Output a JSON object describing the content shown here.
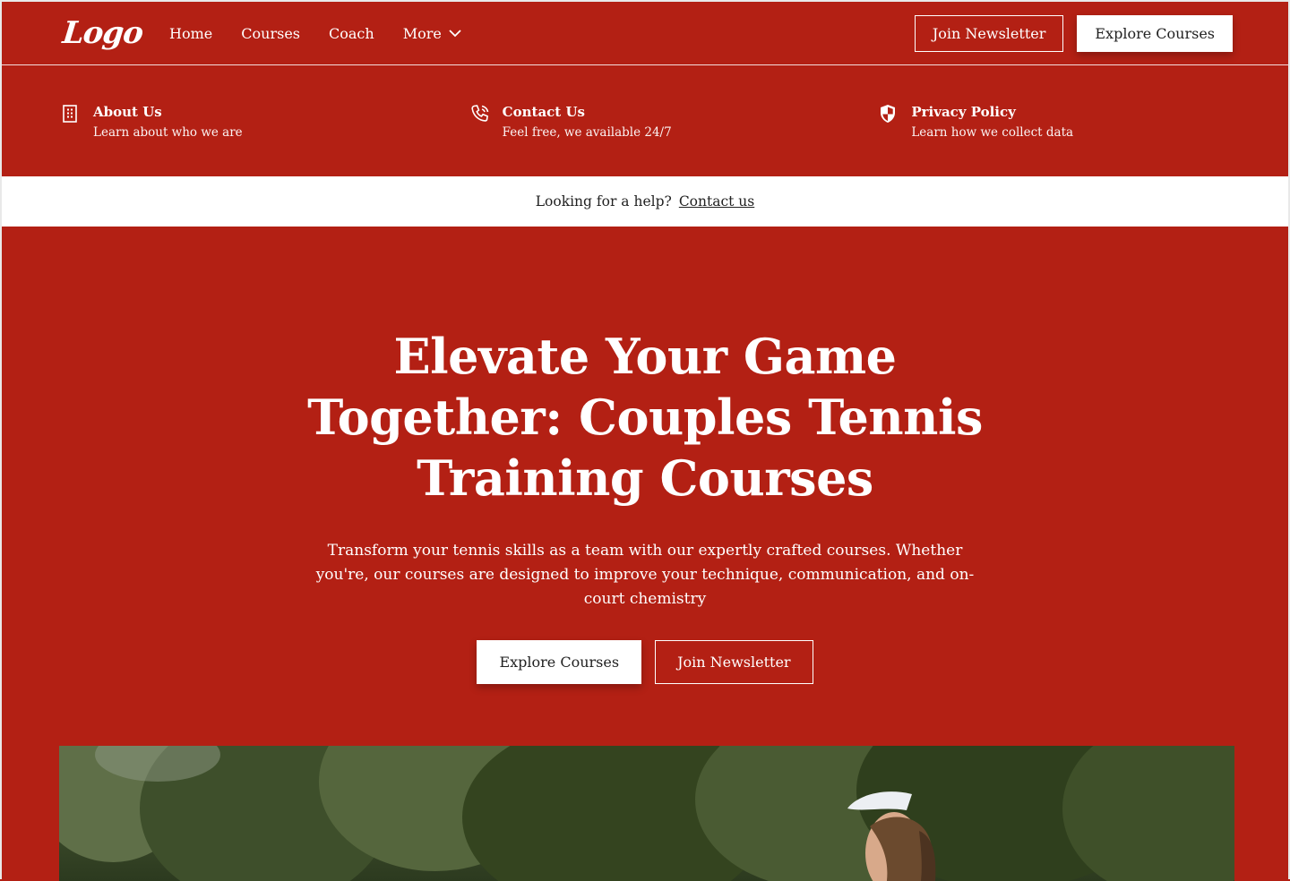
{
  "nav": {
    "logo": "Logo",
    "links": [
      "Home",
      "Courses",
      "Coach",
      "More"
    ],
    "join_newsletter": "Join Newsletter",
    "explore_courses": "Explore Courses"
  },
  "mega": [
    {
      "title": "About Us",
      "subtitle": "Learn about who we are",
      "icon": "building-icon"
    },
    {
      "title": "Contact Us",
      "subtitle": "Feel free, we available 24/7",
      "icon": "phone-icon"
    },
    {
      "title": "Privacy Policy",
      "subtitle": "Learn how we collect data",
      "icon": "shield-icon"
    }
  ],
  "help": {
    "text": "Looking for a help?",
    "link": "Contact us"
  },
  "hero": {
    "title": "Elevate Your Game Together: Couples Tennis Training Courses",
    "description": "Transform your tennis skills as a team with our expertly crafted courses. Whether you're, our courses are designed to improve your technique, communication, and on-court chemistry",
    "primary": "Explore Courses",
    "secondary": "Join Newsletter"
  },
  "colors": {
    "brand": "#b32014",
    "white": "#ffffff"
  }
}
